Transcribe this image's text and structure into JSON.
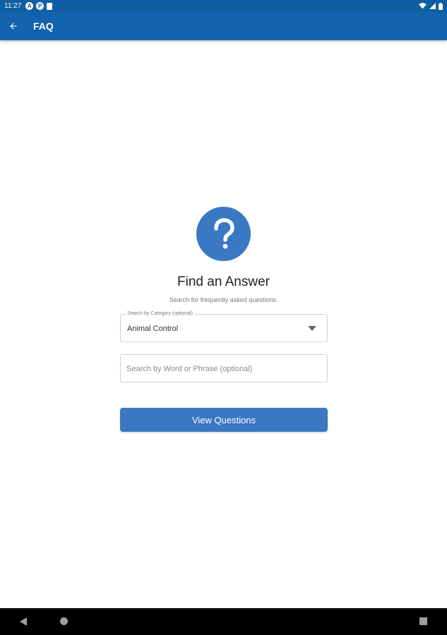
{
  "status_bar": {
    "time": "11:27",
    "notification_icons": [
      "a-icon",
      "p-icon",
      "clipboard-icon"
    ],
    "system_icons": [
      "wifi-icon",
      "signal-icon",
      "battery-icon"
    ]
  },
  "app_bar": {
    "title": "FAQ",
    "back_icon": "arrow-back-icon",
    "color": "#1262ad"
  },
  "hero": {
    "icon": "question-mark-icon",
    "icon_color": "#3a78c3",
    "title": "Find an Answer",
    "subtitle": "Search for frequently asked questions."
  },
  "form": {
    "category": {
      "label": "Search by Category (optional)",
      "selected": "Animal Control"
    },
    "search": {
      "placeholder": "Search by Word or Phrase (optional)",
      "value": ""
    },
    "submit_label": "View Questions"
  },
  "nav_bar": {
    "buttons": [
      "back-triangle-icon",
      "home-circle-icon",
      "recents-square-icon"
    ]
  }
}
